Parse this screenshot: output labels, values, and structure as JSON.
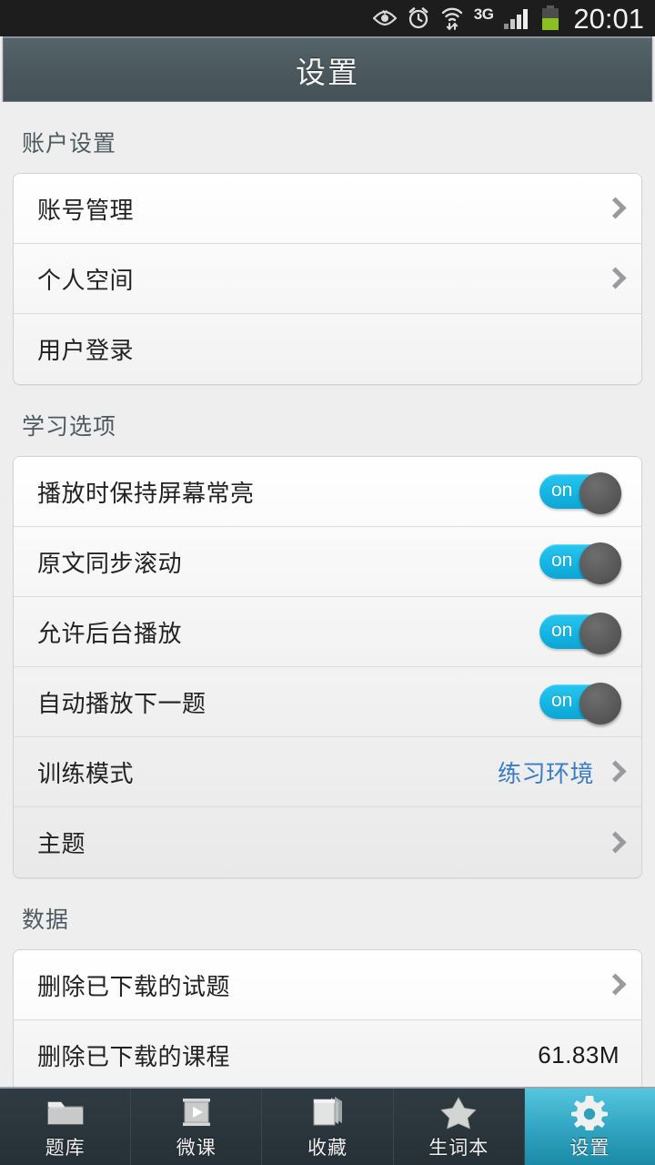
{
  "status_bar": {
    "icons": [
      "eye-icon",
      "alarm-clock-icon",
      "wifi-data-icon",
      "network-type-label",
      "signal-bars-icon",
      "battery-icon"
    ],
    "network_type": "3G",
    "time": "20:01"
  },
  "title_bar": {
    "title": "设置"
  },
  "sections": [
    {
      "header": "账户设置",
      "rows": [
        {
          "label": "账号管理",
          "value": "",
          "accessory": "chevron"
        },
        {
          "label": "个人空间",
          "value": "",
          "accessory": "chevron"
        },
        {
          "label": "用户登录",
          "value": "",
          "accessory": "none"
        }
      ]
    },
    {
      "header": "学习选项",
      "rows": [
        {
          "label": "播放时保持屏幕常亮",
          "value": "on",
          "accessory": "toggle"
        },
        {
          "label": "原文同步滚动",
          "value": "on",
          "accessory": "toggle"
        },
        {
          "label": "允许后台播放",
          "value": "on",
          "accessory": "toggle"
        },
        {
          "label": "自动播放下一题",
          "value": "on",
          "accessory": "toggle"
        },
        {
          "label": "训练模式",
          "value": "练习环境",
          "accessory": "value-chevron"
        },
        {
          "label": "主题",
          "value": "",
          "accessory": "chevron"
        }
      ]
    },
    {
      "header": "数据",
      "rows": [
        {
          "label": "删除已下载的试题",
          "value": "",
          "accessory": "chevron"
        },
        {
          "label": "删除已下载的课程",
          "value": "61.83M",
          "accessory": "plain-value"
        }
      ]
    }
  ],
  "tab_bar": {
    "tabs": [
      {
        "label": "题库",
        "icon": "folder-icon",
        "active": false
      },
      {
        "label": "微课",
        "icon": "video-play-icon",
        "active": false
      },
      {
        "label": "收藏",
        "icon": "book-icon",
        "active": false
      },
      {
        "label": "生词本",
        "icon": "star-icon",
        "active": false
      },
      {
        "label": "设置",
        "icon": "gear-icon",
        "active": true
      }
    ]
  },
  "colors": {
    "accent_cyan": "#13b4e2",
    "title_bar": "#4a585e",
    "background": "#eeeeee",
    "link_blue": "#3b7cc4",
    "tab_active": "#35a9c6",
    "tab_bar": "#28333a",
    "battery_green": "#8bc022"
  }
}
